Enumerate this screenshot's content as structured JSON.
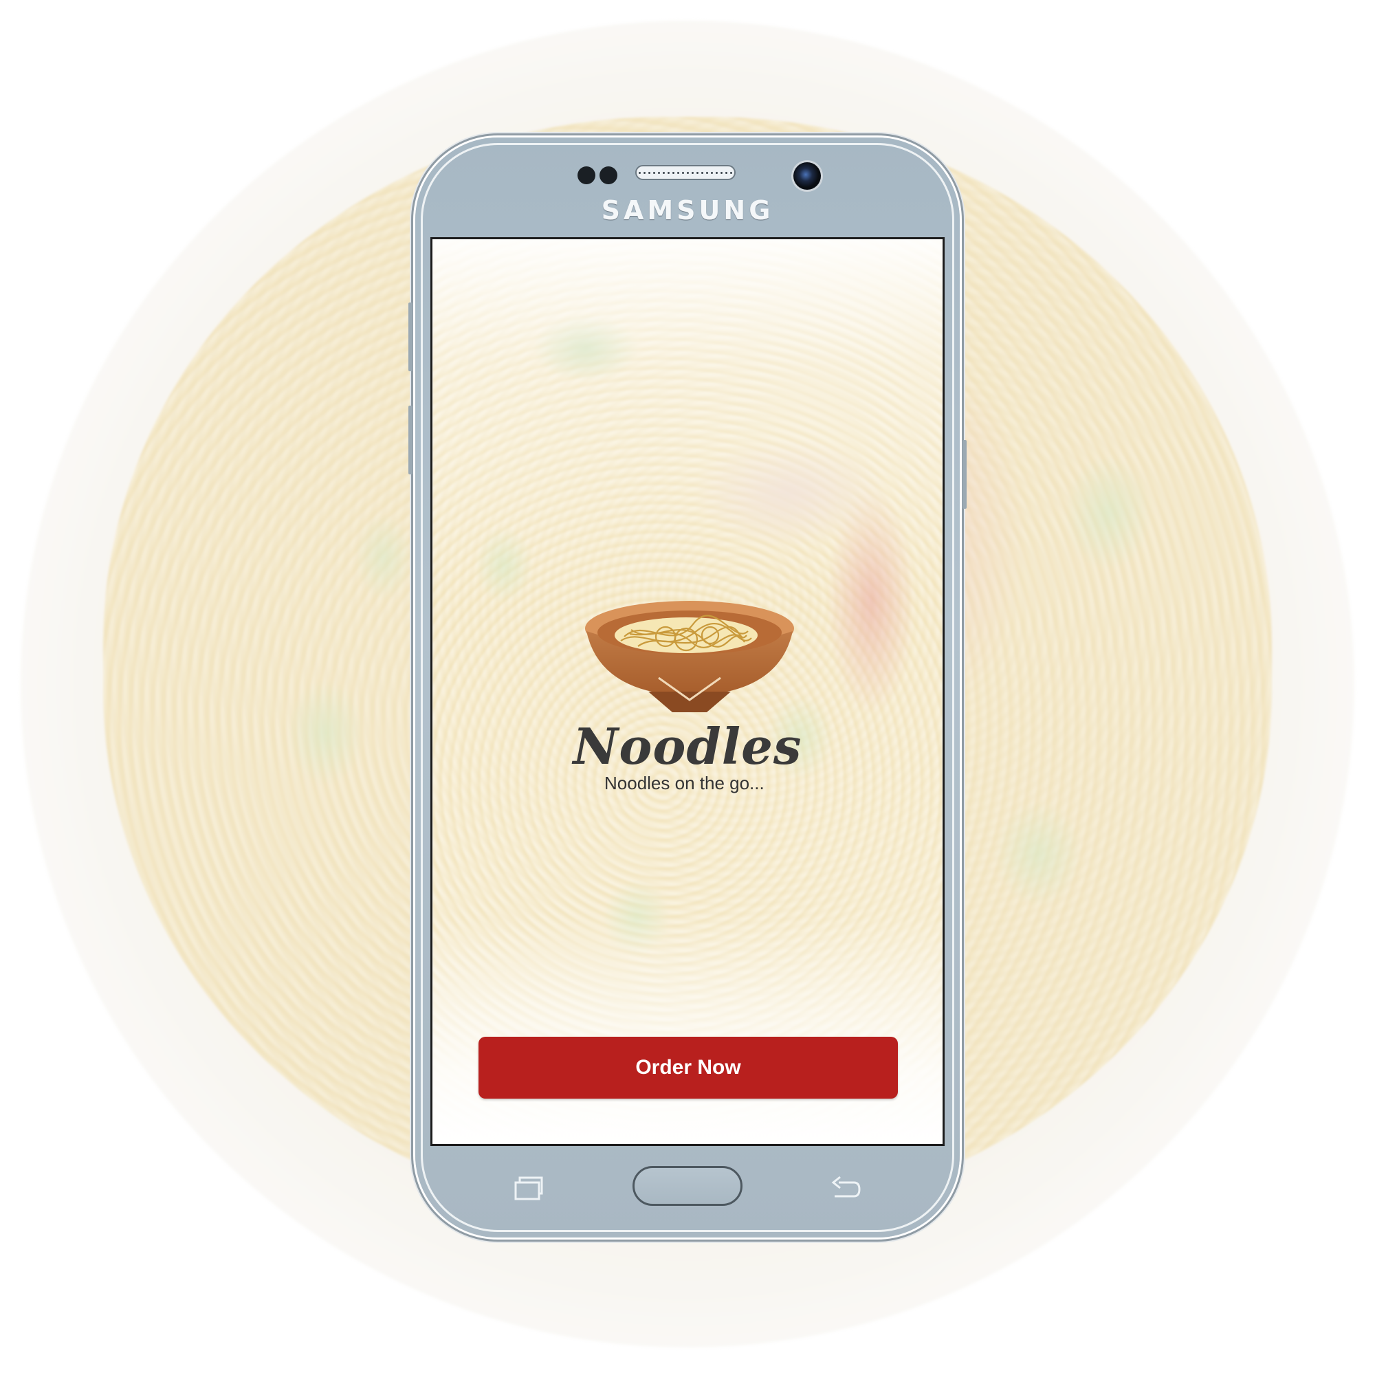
{
  "device": {
    "brand": "SAMSUNG"
  },
  "app": {
    "logo_title": "Noodles",
    "tagline": "Noodles on the go...",
    "order_button_label": "Order Now",
    "accent_color": "#b8201e"
  },
  "icons": {
    "logo": "noodle-bowl-icon",
    "recents": "recents-icon",
    "home": "home-button-icon",
    "back": "back-arrow-icon"
  }
}
